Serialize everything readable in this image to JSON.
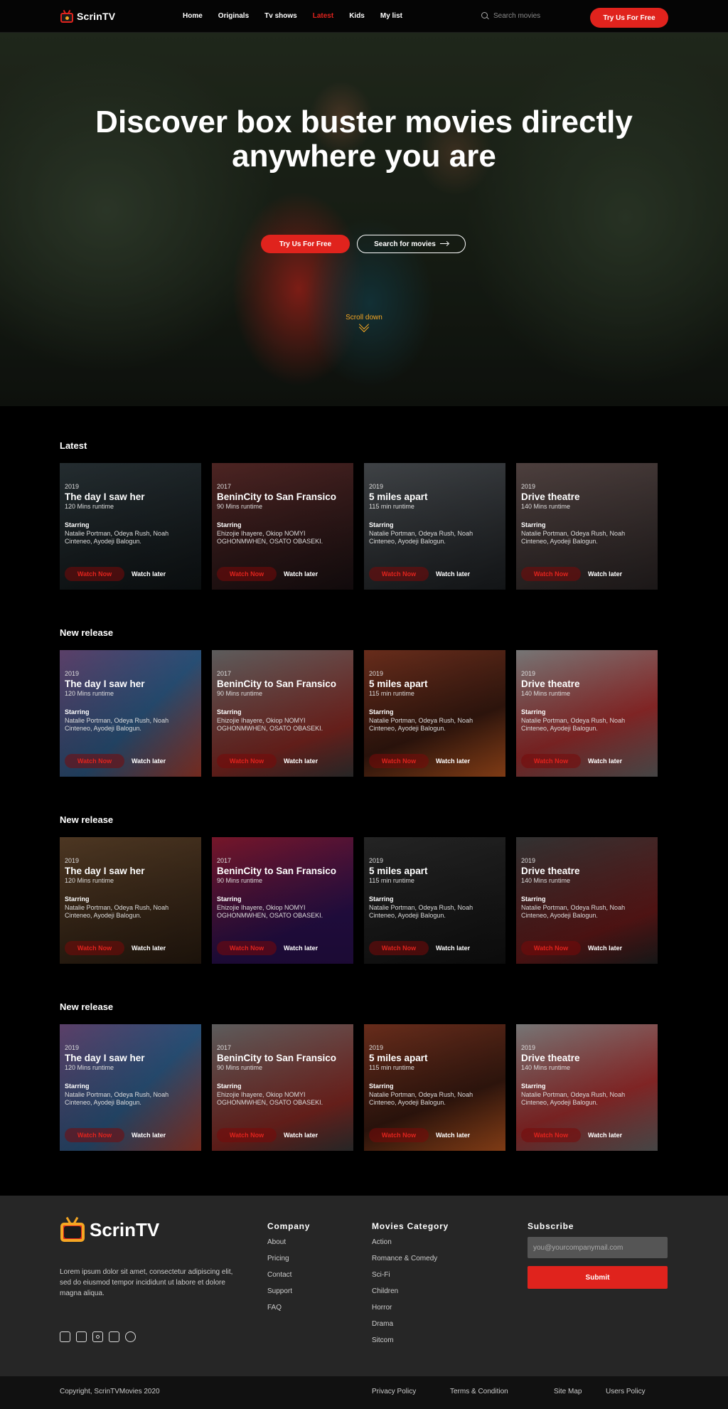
{
  "brand": {
    "name": "ScrinTV",
    "accent": "#e0231d",
    "secondary": "#f5a623"
  },
  "nav": {
    "links": [
      "Home",
      "Originals",
      "Tv shows",
      "Latest",
      "Kids",
      "My list"
    ],
    "active": "Latest",
    "search_placeholder": "Search movies",
    "cta": "Try Us For Free"
  },
  "hero": {
    "title_line1": "Discover box buster movies directly",
    "title_line2": "anywhere you are",
    "primary_button": "Try Us For Free",
    "secondary_button": "Search for movies",
    "scroll_label": "Scroll down"
  },
  "common": {
    "starring_label": "Starring",
    "watch_now": "Watch Now",
    "watch_later": "Watch later"
  },
  "sections": [
    {
      "title": "Latest",
      "cards": [
        {
          "year": "2019",
          "title": "The day I saw her",
          "runtime": "120 Mins runtime",
          "cast_line1": "Natalie Portman, Odeya Rush, Noah",
          "cast_line2": "Cinteneo, Ayodeji Balogun."
        },
        {
          "year": "2017",
          "title": "BeninCity to San Fransico",
          "runtime": "90 Mins runtime",
          "cast_line1": "Ehizojie Ihayere, Okiop NOMYI",
          "cast_line2": "OGHONMWHEN, OSATO OBASEKI."
        },
        {
          "year": "2019",
          "title": "5 miles apart",
          "runtime": "115 min runtime",
          "cast_line1": "Natalie Portman, Odeya Rush, Noah",
          "cast_line2": "Cinteneo, Ayodeji Balogun."
        },
        {
          "year": "2019",
          "title": "Drive theatre",
          "runtime": "140 Mins runtime",
          "cast_line1": "Natalie Portman, Odeya Rush, Noah",
          "cast_line2": "Cinteneo, Ayodeji Balogun."
        }
      ]
    },
    {
      "title": "New release",
      "cards": [
        {
          "year": "2019",
          "title": "The day I saw her",
          "runtime": "120 Mins runtime",
          "cast_line1": "Natalie Portman, Odeya Rush, Noah",
          "cast_line2": "Cinteneo, Ayodeji Balogun."
        },
        {
          "year": "2017",
          "title": "BeninCity to San Fransico",
          "runtime": "90 Mins runtime",
          "cast_line1": "Ehizojie Ihayere, Okiop NOMYI",
          "cast_line2": "OGHONMWHEN, OSATO OBASEKI."
        },
        {
          "year": "2019",
          "title": "5 miles apart",
          "runtime": "115 min runtime",
          "cast_line1": "Natalie Portman, Odeya Rush, Noah",
          "cast_line2": "Cinteneo, Ayodeji Balogun."
        },
        {
          "year": "2019",
          "title": "Drive theatre",
          "runtime": "140 Mins runtime",
          "cast_line1": "Natalie Portman, Odeya Rush, Noah",
          "cast_line2": "Cinteneo, Ayodeji Balogun."
        }
      ]
    },
    {
      "title": "New release",
      "cards": [
        {
          "year": "2019",
          "title": "The day I saw her",
          "runtime": "120 Mins runtime",
          "cast_line1": "Natalie Portman, Odeya Rush, Noah",
          "cast_line2": "Cinteneo, Ayodeji Balogun."
        },
        {
          "year": "2017",
          "title": "BeninCity to San Fransico",
          "runtime": "90 Mins runtime",
          "cast_line1": "Ehizojie Ihayere, Okiop NOMYI",
          "cast_line2": "OGHONMWHEN, OSATO OBASEKI."
        },
        {
          "year": "2019",
          "title": "5 miles apart",
          "runtime": "115 min runtime",
          "cast_line1": "Natalie Portman, Odeya Rush, Noah",
          "cast_line2": "Cinteneo, Ayodeji Balogun."
        },
        {
          "year": "2019",
          "title": "Drive theatre",
          "runtime": "140 Mins runtime",
          "cast_line1": "Natalie Portman, Odeya Rush, Noah",
          "cast_line2": "Cinteneo, Ayodeji Balogun."
        }
      ]
    },
    {
      "title": "New release",
      "cards": [
        {
          "year": "2019",
          "title": "The day I saw her",
          "runtime": "120 Mins runtime",
          "cast_line1": "Natalie Portman, Odeya Rush, Noah",
          "cast_line2": "Cinteneo, Ayodeji Balogun."
        },
        {
          "year": "2017",
          "title": "BeninCity to San Fransico",
          "runtime": "90 Mins runtime",
          "cast_line1": "Ehizojie Ihayere, Okiop NOMYI",
          "cast_line2": "OGHONMWHEN, OSATO OBASEKI."
        },
        {
          "year": "2019",
          "title": "5 miles apart",
          "runtime": "115 min runtime",
          "cast_line1": "Natalie Portman, Odeya Rush, Noah",
          "cast_line2": "Cinteneo, Ayodeji Balogun."
        },
        {
          "year": "2019",
          "title": "Drive theatre",
          "runtime": "140 Mins runtime",
          "cast_line1": "Natalie Portman, Odeya Rush, Noah",
          "cast_line2": "Cinteneo, Ayodeji Balogun."
        }
      ]
    }
  ],
  "footer": {
    "brand": "ScrinTV",
    "about": "Lorem ipsum dolor sit amet, consectetur adipiscing elit, sed do eiusmod tempor incididunt ut labore et dolore magna aliqua.",
    "socials": [
      "facebook-icon",
      "twitter-icon",
      "instagram-icon",
      "linkedin-icon",
      "reddit-icon"
    ],
    "company_title": "Company",
    "company_links": [
      "About",
      "Pricing",
      "Contact",
      "Support",
      "FAQ"
    ],
    "category_title": "Movies Category",
    "category_links": [
      "Action",
      "Romance & Comedy",
      "Sci-Fi",
      "Children",
      "Horror",
      "Drama",
      "Sitcom"
    ],
    "subscribe_title": "Subscribe",
    "subscribe_placeholder": "you@yourcompanymail.com",
    "subscribe_button": "Submit"
  },
  "bottom": {
    "copyright": "Copyright, ScrinTVMovies 2020",
    "links": [
      "Privacy Policy",
      "Terms & Condition",
      "Site Map",
      "Users Policy"
    ]
  }
}
